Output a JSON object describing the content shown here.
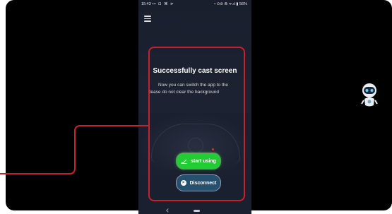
{
  "status_bar": {
    "time": "15:43",
    "left_icons": "⊶ ⊡ ⌘ ⊳",
    "right_icons": "• ⊙⊘ ⋒ ᯤ.ıl ▮ 56%"
  },
  "cast": {
    "title": "Successfully cast screen",
    "message_line1": "Now you can switch the app to the",
    "message_line2": "lease do not clear the background"
  },
  "buttons": {
    "start_using": "start using",
    "disconnect": "Disconnect"
  },
  "colors": {
    "highlight": "#c5222a",
    "start_button": "#22cc33",
    "disconnect_button": "#27506f",
    "phone_bg": "#1a1f2e"
  },
  "icons": {
    "menu": "hamburger-menu-icon",
    "start": "cast-check-icon",
    "disconnect": "close-circle-icon",
    "assistant": "robot-assistant-icon"
  }
}
